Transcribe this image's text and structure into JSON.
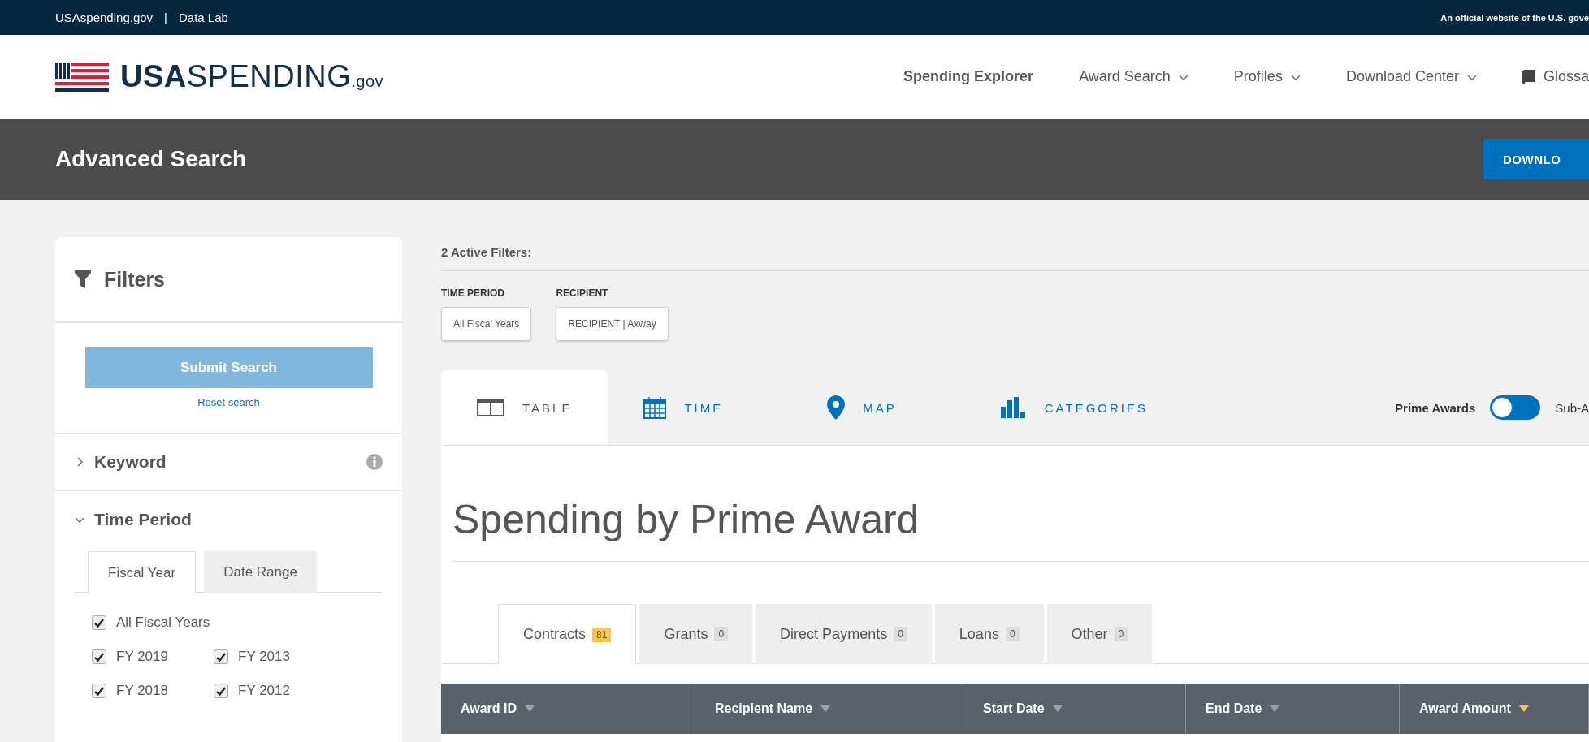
{
  "top_bar": {
    "links": [
      "USAspending.gov",
      "Data Lab"
    ],
    "separator": "|",
    "notice": "An official website of the U.S. gove"
  },
  "header": {
    "logo": {
      "bold": "USA",
      "main": "SPENDING",
      "suffix": ".gov"
    },
    "nav": [
      {
        "label": "Spending Explorer",
        "kind": "link"
      },
      {
        "label": "Award Search",
        "kind": "menu"
      },
      {
        "label": "Profiles",
        "kind": "menu"
      },
      {
        "label": "Download Center",
        "kind": "menu"
      },
      {
        "label": "Glossa",
        "kind": "glossary"
      }
    ]
  },
  "title_bar": {
    "title": "Advanced Search",
    "button": "DOWNLO"
  },
  "sidebar": {
    "title": "Filters",
    "submit": "Submit Search",
    "reset": "Reset search",
    "sections": [
      {
        "label": "Keyword",
        "expanded": false,
        "info": true
      },
      {
        "label": "Time Period",
        "expanded": true,
        "info": false
      }
    ],
    "period_tabs": [
      {
        "label": "Fiscal Year",
        "selected": true
      },
      {
        "label": "Date Range",
        "selected": false
      }
    ],
    "all_years": {
      "label": "All Fiscal Years",
      "checked": true
    },
    "years": [
      {
        "label": "FY 2019",
        "checked": true
      },
      {
        "label": "FY 2013",
        "checked": true
      },
      {
        "label": "FY 2018",
        "checked": true
      },
      {
        "label": "FY 2012",
        "checked": true
      }
    ]
  },
  "active_filters": {
    "title": "2 Active Filters:",
    "groups": [
      {
        "label": "TIME PERIOD",
        "chip": "All Fiscal Years"
      },
      {
        "label": "RECIPIENT",
        "chip": "RECIPIENT | Axway"
      }
    ]
  },
  "view_tabs": [
    {
      "label": "TABLE",
      "kind": "table",
      "selected": true
    },
    {
      "label": "TIME",
      "kind": "time",
      "selected": false
    },
    {
      "label": "MAP",
      "kind": "map",
      "selected": false
    },
    {
      "label": "CATEGORIES",
      "kind": "categories",
      "selected": false
    }
  ],
  "award_toggle": {
    "left": "Prime Awards",
    "right": "Sub-A",
    "on": false
  },
  "heading": "Spending by Prime Award",
  "award_tabs": [
    {
      "label": "Contracts",
      "count": "81",
      "selected": true
    },
    {
      "label": "Grants",
      "count": "0",
      "selected": false
    },
    {
      "label": "Direct Payments",
      "count": "0",
      "selected": false
    },
    {
      "label": "Loans",
      "count": "0",
      "selected": false
    },
    {
      "label": "Other",
      "count": "0",
      "selected": false
    }
  ],
  "table": {
    "columns": [
      {
        "label": "Award ID",
        "sorted": false
      },
      {
        "label": "Recipient Name",
        "sorted": false
      },
      {
        "label": "Start Date",
        "sorted": false
      },
      {
        "label": "End Date",
        "sorted": false
      },
      {
        "label": "Award Amount",
        "sorted": true
      }
    ]
  }
}
